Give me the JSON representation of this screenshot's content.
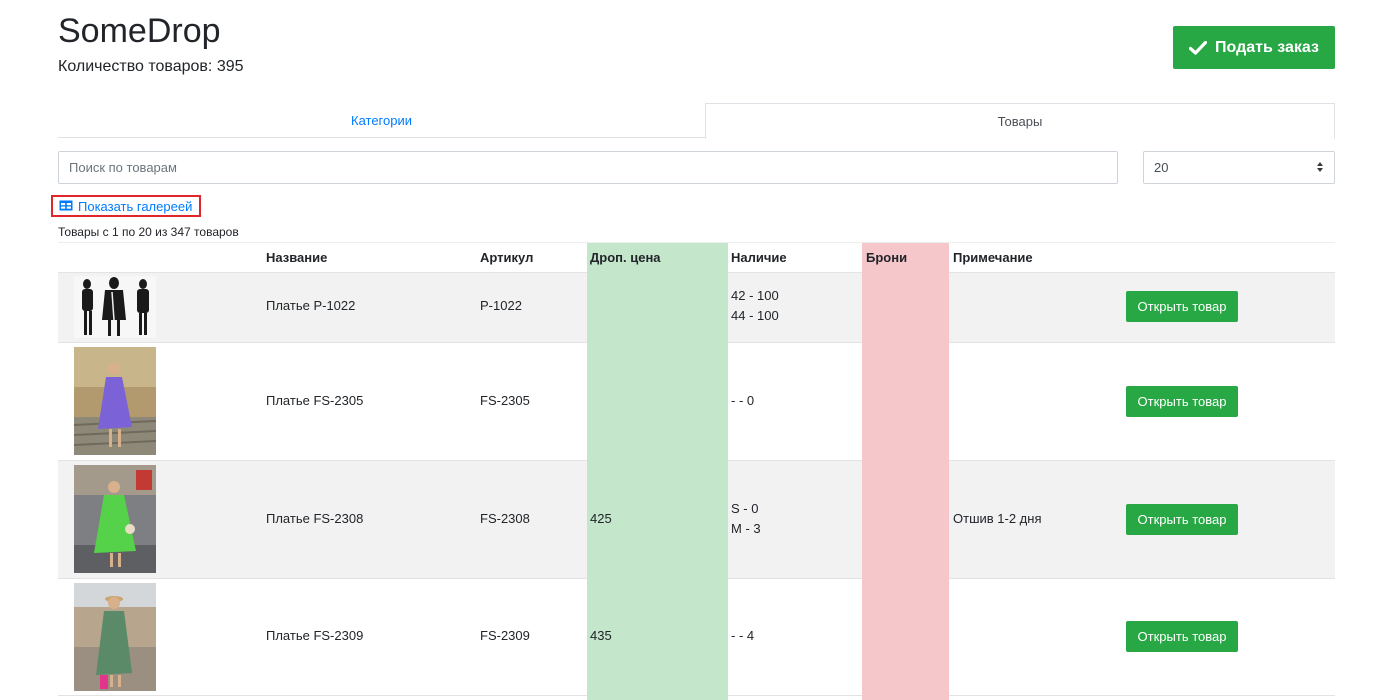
{
  "app": {
    "title": "SomeDrop",
    "count_label": "Количество товаров: 395"
  },
  "actions": {
    "order_label": "Подать заказ",
    "open_label": "Открыть товар"
  },
  "tabs": [
    {
      "label": "Категории"
    },
    {
      "label": "Товары"
    }
  ],
  "search": {
    "placeholder": "Поиск по товарам",
    "value": ""
  },
  "per_page": {
    "selected": "20"
  },
  "gallery": {
    "label": "Показать галереей"
  },
  "range_text": "Товары с 1 по 20 из 347 товаров",
  "table": {
    "headers": {
      "name": "Название",
      "sku": "Артикул",
      "price": "Дроп. цена",
      "stock": "Наличие",
      "reserve": "Брони",
      "note": "Примечание"
    },
    "rows": [
      {
        "name": "Платье P-1022",
        "sku": "P-1022",
        "price": "",
        "stock": [
          "42 - 100",
          "44 - 100"
        ],
        "reserve": "",
        "note": ""
      },
      {
        "name": "Платье FS-2305",
        "sku": "FS-2305",
        "price": "",
        "stock": [
          "- - 0"
        ],
        "reserve": "",
        "note": ""
      },
      {
        "name": "Платье FS-2308",
        "sku": "FS-2308",
        "price": "425",
        "stock": [
          "S - 0",
          "M - 3"
        ],
        "reserve": "",
        "note": "Отшив 1-2 дня"
      },
      {
        "name": "Платье FS-2309",
        "sku": "FS-2309",
        "price": "435",
        "stock": [
          "- - 4"
        ],
        "reserve": "",
        "note": ""
      }
    ]
  },
  "colors": {
    "accent": "#28a745",
    "link": "#007bff",
    "price_col": "#c4e6cb",
    "reserve_col": "#f5c6ca",
    "highlight_box": "#e0262a"
  }
}
